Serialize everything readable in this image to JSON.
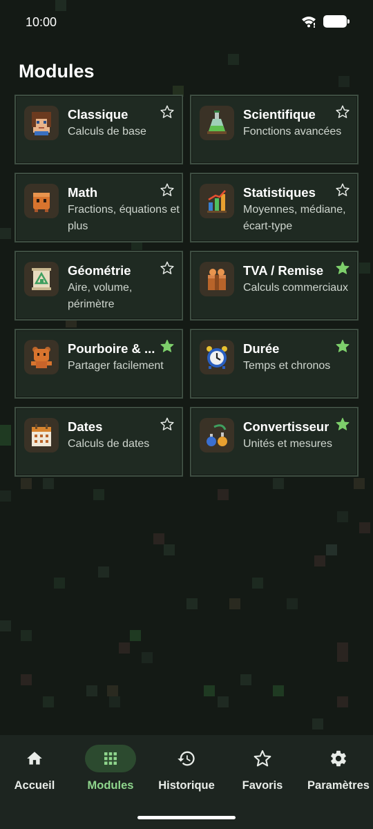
{
  "status_bar": {
    "time": "10:00"
  },
  "page": {
    "title": "Modules"
  },
  "colors": {
    "accent": "#8fd68d",
    "star_filled": "#7dcf6b",
    "card_bg": "#1f2a22",
    "card_border": "#3e4e42"
  },
  "modules": [
    {
      "title": "Classique",
      "subtitle": "Calculs de base",
      "icon": "face-icon",
      "favorite": false
    },
    {
      "title": "Scientifique",
      "subtitle": "Fonctions avancées",
      "icon": "flask-icon",
      "favorite": false
    },
    {
      "title": "Math",
      "subtitle": "Fractions, équations et plus",
      "icon": "cube-creature-icon",
      "favorite": false
    },
    {
      "title": "Statistiques",
      "subtitle": "Moyennes, médiane, écart-type",
      "icon": "bar-chart-icon",
      "favorite": false
    },
    {
      "title": "Géométrie",
      "subtitle": "Aire, volume, périmètre",
      "icon": "scroll-map-icon",
      "favorite": false
    },
    {
      "title": "TVA / Remise",
      "subtitle": "Calculs commerciaux",
      "icon": "box-icon",
      "favorite": true
    },
    {
      "title": "Pourboire & ...",
      "subtitle": "Partager facilement",
      "icon": "bear-icon",
      "favorite": true
    },
    {
      "title": "Durée",
      "subtitle": "Temps et chronos",
      "icon": "alarm-clock-icon",
      "favorite": true
    },
    {
      "title": "Dates",
      "subtitle": "Calculs de dates",
      "icon": "calendar-icon",
      "favorite": false
    },
    {
      "title": "Convertisseur",
      "subtitle": "Unités et mesures",
      "icon": "potions-icon",
      "favorite": true
    }
  ],
  "nav": {
    "items": [
      {
        "label": "Accueil",
        "icon": "home-icon"
      },
      {
        "label": "Modules",
        "icon": "grid-icon"
      },
      {
        "label": "Historique",
        "icon": "history-icon"
      },
      {
        "label": "Favoris",
        "icon": "star-icon"
      },
      {
        "label": "Paramètres",
        "icon": "gear-icon"
      }
    ],
    "active": "Modules"
  }
}
